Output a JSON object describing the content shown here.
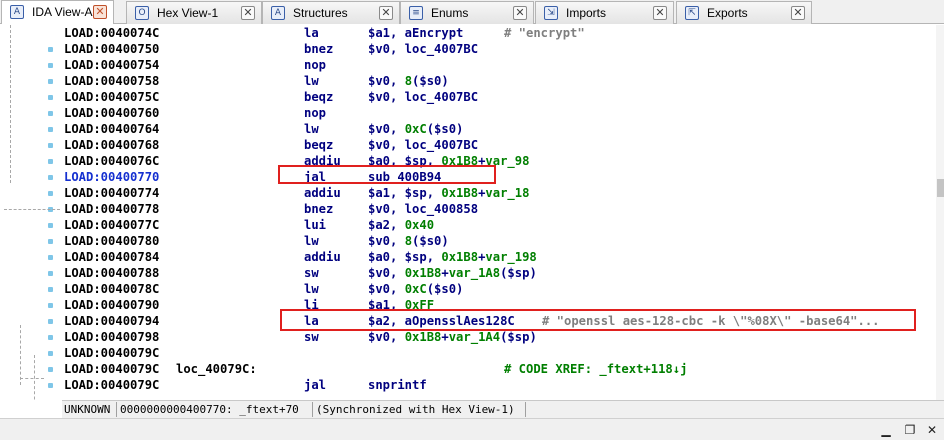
{
  "tabs": [
    {
      "label": "IDA View-A",
      "icon": "text-view-icon",
      "active": true
    },
    {
      "label": "Hex View-1",
      "icon": "hex-view-icon",
      "active": false
    },
    {
      "label": "Structures",
      "icon": "structures-icon",
      "active": false
    },
    {
      "label": "Enums",
      "icon": "enums-icon",
      "active": false
    },
    {
      "label": "Imports",
      "icon": "imports-icon",
      "active": false
    },
    {
      "label": "Exports",
      "icon": "exports-icon",
      "active": false
    }
  ],
  "tab_glyphs": [
    "A",
    "O",
    "A",
    "≡",
    "⇲",
    "⇱"
  ],
  "close_glyph": "✕",
  "lines": [
    {
      "addr": "LOAD:0040074C",
      "label": "",
      "mn": "la",
      "op": "$a1, aEncrypt",
      "comment": "# \"encrypt\""
    },
    {
      "addr": "LOAD:00400750",
      "label": "",
      "mn": "bnez",
      "op": "$v0, loc_4007BC",
      "comment": ""
    },
    {
      "addr": "LOAD:00400754",
      "label": "",
      "mn": "nop",
      "op": "",
      "comment": ""
    },
    {
      "addr": "LOAD:00400758",
      "label": "",
      "mn": "lw",
      "op": "$v0, 8($s0)",
      "comment": ""
    },
    {
      "addr": "LOAD:0040075C",
      "label": "",
      "mn": "beqz",
      "op": "$v0, loc_4007BC",
      "comment": ""
    },
    {
      "addr": "LOAD:00400760",
      "label": "",
      "mn": "nop",
      "op": "",
      "comment": ""
    },
    {
      "addr": "LOAD:00400764",
      "label": "",
      "mn": "lw",
      "op": "$v0, 0xC($s0)",
      "comment": ""
    },
    {
      "addr": "LOAD:00400768",
      "label": "",
      "mn": "beqz",
      "op": "$v0, loc_4007BC",
      "comment": ""
    },
    {
      "addr": "LOAD:0040076C",
      "label": "",
      "mn": "addiu",
      "op": "$a0, $sp, 0x1B8+var_98",
      "comment": ""
    },
    {
      "addr": "LOAD:00400770",
      "label": "",
      "mn": "jal",
      "op": "sub_400B94",
      "comment": "",
      "current": true
    },
    {
      "addr": "LOAD:00400774",
      "label": "",
      "mn": "addiu",
      "op": "$a1, $sp, 0x1B8+var_18",
      "comment": ""
    },
    {
      "addr": "LOAD:00400778",
      "label": "",
      "mn": "bnez",
      "op": "$v0, loc_400858",
      "comment": ""
    },
    {
      "addr": "LOAD:0040077C",
      "label": "",
      "mn": "lui",
      "op": "$a2, 0x40",
      "comment": ""
    },
    {
      "addr": "LOAD:00400780",
      "label": "",
      "mn": "lw",
      "op": "$v0, 8($s0)",
      "comment": ""
    },
    {
      "addr": "LOAD:00400784",
      "label": "",
      "mn": "addiu",
      "op": "$a0, $sp, 0x1B8+var_198",
      "comment": ""
    },
    {
      "addr": "LOAD:00400788",
      "label": "",
      "mn": "sw",
      "op": "$v0, 0x1B8+var_1A8($sp)",
      "comment": ""
    },
    {
      "addr": "LOAD:0040078C",
      "label": "",
      "mn": "lw",
      "op": "$v0, 0xC($s0)",
      "comment": ""
    },
    {
      "addr": "LOAD:00400790",
      "label": "",
      "mn": "li",
      "op": "$a1, 0xFF",
      "comment": ""
    },
    {
      "addr": "LOAD:00400794",
      "label": "",
      "mn": "la",
      "op": "$a2, aOpensslAes128C",
      "comment": "# \"openssl aes-128-cbc -k \\\"%08X\\\" -base64\"..."
    },
    {
      "addr": "LOAD:00400798",
      "label": "",
      "mn": "sw",
      "op": "$v0, 0x1B8+var_1A4($sp)",
      "comment": ""
    },
    {
      "addr": "LOAD:0040079C",
      "label": "",
      "mn": "",
      "op": "",
      "comment": ""
    },
    {
      "addr": "LOAD:0040079C",
      "label": "loc_40079C:",
      "mn": "",
      "op": "",
      "comment": "",
      "xref": "# CODE XREF: _ftext+118↓j"
    },
    {
      "addr": "LOAD:0040079C",
      "label": "",
      "mn": "jal",
      "op": "snprintf",
      "comment": ""
    }
  ],
  "status": {
    "mode": "UNKNOWN",
    "location": "0000000000400770: _ftext+70",
    "sync": "(Synchronized with Hex View-1)"
  },
  "window_buttons": {
    "minimize": "▁",
    "restore": "❐",
    "close": "✕"
  },
  "colors": {
    "highlight_box": "#e0201e",
    "current_address": "#1530d0",
    "mnemonic": "#00007f",
    "numeric": "#007f00",
    "comment": "#7f7f7f"
  }
}
